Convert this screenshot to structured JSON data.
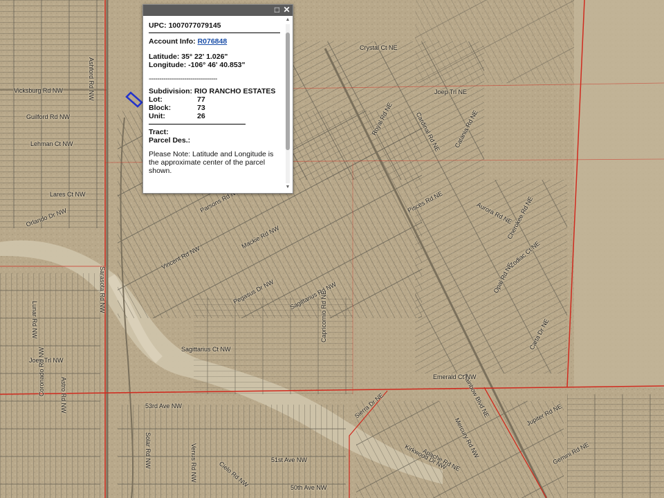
{
  "popup": {
    "upc_label": "UPC:",
    "upc_value": "1007077079145",
    "account_label": "Account Info:",
    "account_link": "R076848",
    "latitude_label": "Latitude:",
    "latitude_value": "35° 22' 1.026\"",
    "longitude_label": "Longitude:",
    "longitude_value": "-106° 46' 40.853\"",
    "separator": "---------------------------------",
    "subdivision_label": "Subdivision:",
    "subdivision_value": "RIO RANCHO ESTATES",
    "lot_label": "Lot:",
    "lot_value": "77",
    "block_label": "Block:",
    "block_value": "73",
    "unit_label": "Unit:",
    "unit_value": "26",
    "tract_label": "Tract:",
    "parcel_label": "Parcel Des.:",
    "note": "Please Note: Latitude and Longitude is the approximate center of the parcel shown.",
    "maximize_icon": "maximize-icon",
    "close_icon": "close-icon"
  },
  "streets": [
    {
      "name": "Vicksburg Rd NW"
    },
    {
      "name": "Guilford Rd NW"
    },
    {
      "name": "Lehman Ct NW"
    },
    {
      "name": "Lares Ct NW"
    },
    {
      "name": "Orlando Dr NW"
    },
    {
      "name": "Ashford Rd NW"
    },
    {
      "name": "Crystal Ct NE"
    },
    {
      "name": "Joep Trl NE"
    },
    {
      "name": "Royal Rd NE"
    },
    {
      "name": "Cardinal Rd NE"
    },
    {
      "name": "Catania Rd NE"
    },
    {
      "name": "Sarasota Rd NW"
    },
    {
      "name": "Parsons Rd NW"
    },
    {
      "name": "Mackie Rd NW"
    },
    {
      "name": "Vincent Rd NW"
    },
    {
      "name": "Pisces Rd NE"
    },
    {
      "name": "Cherokee Rd NE"
    },
    {
      "name": "Sagittarius Rd NW"
    },
    {
      "name": "Sagittarius Ct NW"
    },
    {
      "name": "Pegasus Dr NW"
    },
    {
      "name": "Capricornio Rd NE"
    },
    {
      "name": "Aurora Rd NE"
    },
    {
      "name": "Rainbow Blvd NE"
    },
    {
      "name": "Emerald Ct NW"
    },
    {
      "name": "Opal Rd NE"
    },
    {
      "name": "53rd Ave NW"
    },
    {
      "name": "51st Ave NW"
    },
    {
      "name": "50th Ave NW"
    },
    {
      "name": "Astro Rd NW"
    },
    {
      "name": "Lunar Rd NW"
    },
    {
      "name": "Joep Trl NW"
    },
    {
      "name": "Coronado Rd NW"
    },
    {
      "name": "Cielo Rd NW"
    },
    {
      "name": "Solar Rd NW"
    },
    {
      "name": "Venus Rd NW"
    },
    {
      "name": "Kirkwood Dr NW"
    },
    {
      "name": "Mercury Rd NW"
    },
    {
      "name": "Jupiter Rd NE"
    },
    {
      "name": "Zodiac Ct NE"
    },
    {
      "name": "Sierra Dr NE"
    },
    {
      "name": "Apache Rd NE"
    },
    {
      "name": "Carta Dr NE"
    },
    {
      "name": "Gemini Rd NE"
    }
  ],
  "colors": {
    "terrain": "#b8a88a",
    "parcel_lines": "#5e5a4f",
    "boundary": "#d02a1e",
    "highlight": "#2233cc",
    "popup_titlebar": "#5b5b5b",
    "link": "#1a4ea8"
  }
}
